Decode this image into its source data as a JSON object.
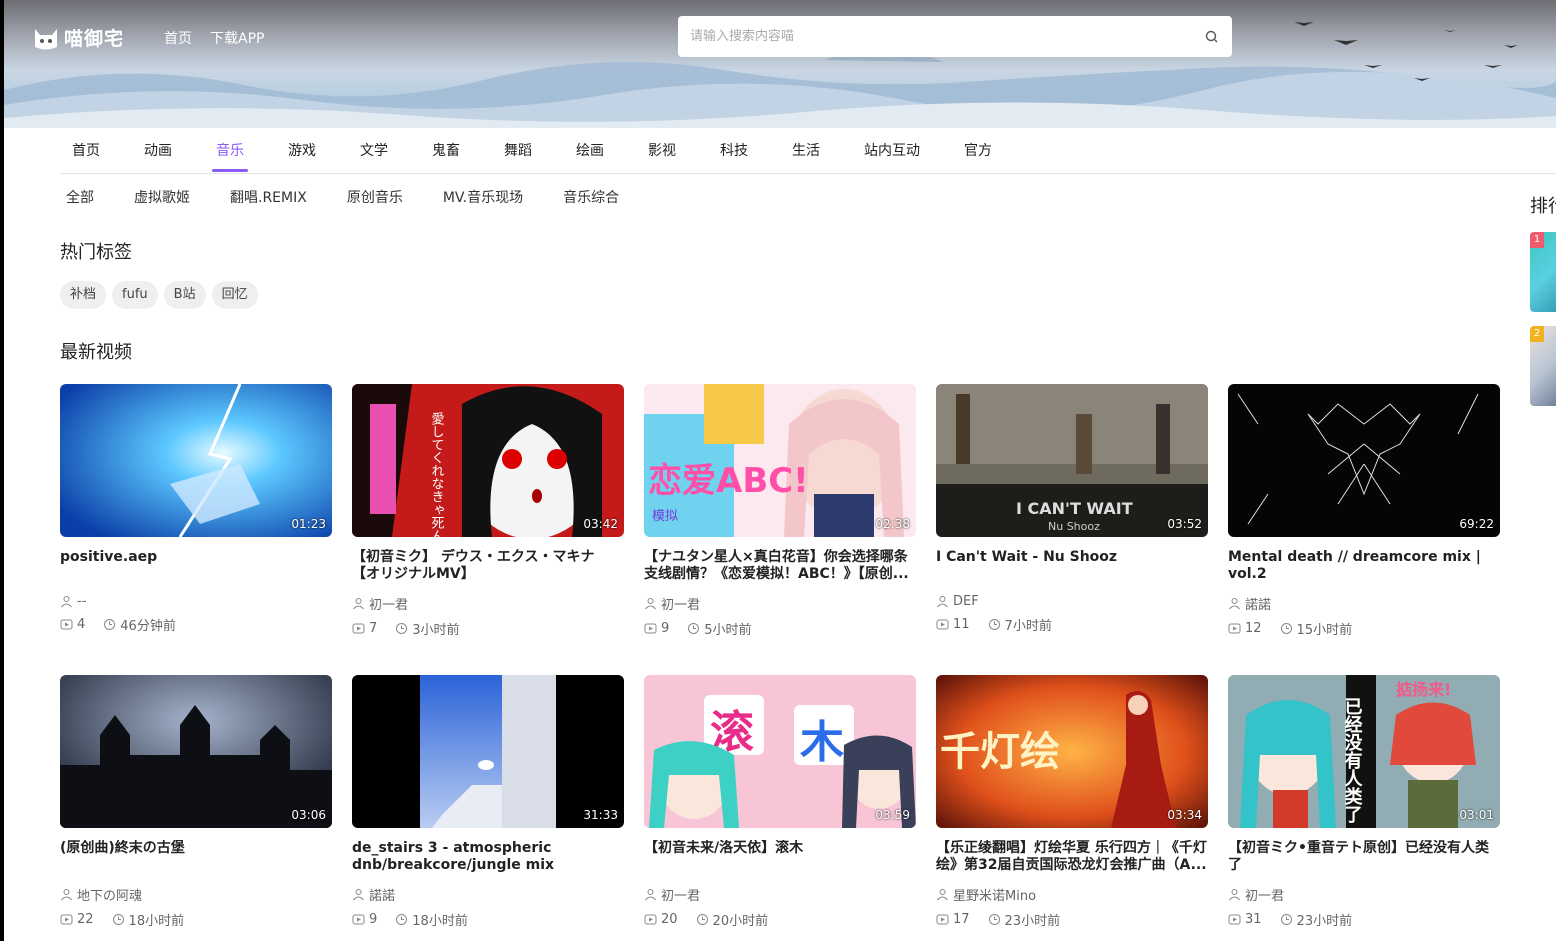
{
  "header": {
    "logo_text": "喵御宅",
    "nav": [
      "首页",
      "下载APP"
    ],
    "search_placeholder": "请输入搜索内容喵"
  },
  "categories": [
    "首页",
    "动画",
    "音乐",
    "游戏",
    "文学",
    "鬼畜",
    "舞蹈",
    "绘画",
    "影视",
    "科技",
    "生活",
    "站内互动",
    "官方"
  ],
  "active_category": "音乐",
  "subcategories": [
    "全部",
    "虚拟歌姬",
    "翻唱.REMIX",
    "原创音乐",
    "MV.音乐现场",
    "音乐综合"
  ],
  "hot_tags_title": "热门标签",
  "hot_tags": [
    "补档",
    "fufu",
    "B站",
    "回忆"
  ],
  "latest_title": "最新视频",
  "sidebar": {
    "title": "排行",
    "ranks": [
      "1",
      "2"
    ]
  },
  "videos": [
    {
      "title": "positive.aep",
      "author": "--",
      "plays": "4",
      "time": "46分钟前",
      "duration": "01:23"
    },
    {
      "title": "【初音ミク】 デウス・エクス・マキナ 【オリジナルMV】",
      "author": "初一君",
      "plays": "7",
      "time": "3小时前",
      "duration": "03:42"
    },
    {
      "title": "【ナユタン星人×真白花音】你会选择哪条支线剧情？《恋爱模拟！ABC！》【原创...",
      "author": "初一君",
      "plays": "9",
      "time": "5小时前",
      "duration": "02:38"
    },
    {
      "title": "I Can't Wait - Nu Shooz",
      "author": "DEF",
      "plays": "11",
      "time": "7小时前",
      "duration": "03:52"
    },
    {
      "title": "Mental death // dreamcore mix | vol.2",
      "author": "諾諾",
      "plays": "12",
      "time": "15小时前",
      "duration": "69:22"
    },
    {
      "title": "(原创曲)終末の古堡",
      "author": "地下の阿魂",
      "plays": "22",
      "time": "18小时前",
      "duration": "03:06"
    },
    {
      "title": "de_stairs 3 - atmospheric dnb/breakcore/jungle mix",
      "author": "諾諾",
      "plays": "9",
      "time": "18小时前",
      "duration": "31:33"
    },
    {
      "title": "【初音未来/洛天依】滚木",
      "author": "初一君",
      "plays": "20",
      "time": "20小时前",
      "duration": "03:59"
    },
    {
      "title": "【乐正绫翻唱】灯绘华夏 乐行四方｜《千灯绘》第32届自贡国际恐龙灯会推广曲（A...",
      "author": "星野米诺Mino",
      "plays": "17",
      "time": "23小时前",
      "duration": "03:34"
    },
    {
      "title": "【初音ミク•重音テト原创】已经没有人类了",
      "author": "初一君",
      "plays": "31",
      "time": "23小时前",
      "duration": "03:01"
    }
  ],
  "thumb_text": {
    "v2": "愛してくれなきゃ死んじゃうよ?",
    "v3": "恋爱ABC!",
    "v3b": "模拟",
    "v4a": "I CAN'T WAIT",
    "v4b": "Nu Shooz",
    "v8a": "滚",
    "v8b": "木",
    "v9": "千灯绘",
    "v10": "已经没有人类了",
    "v10b": "掂扬来!"
  }
}
